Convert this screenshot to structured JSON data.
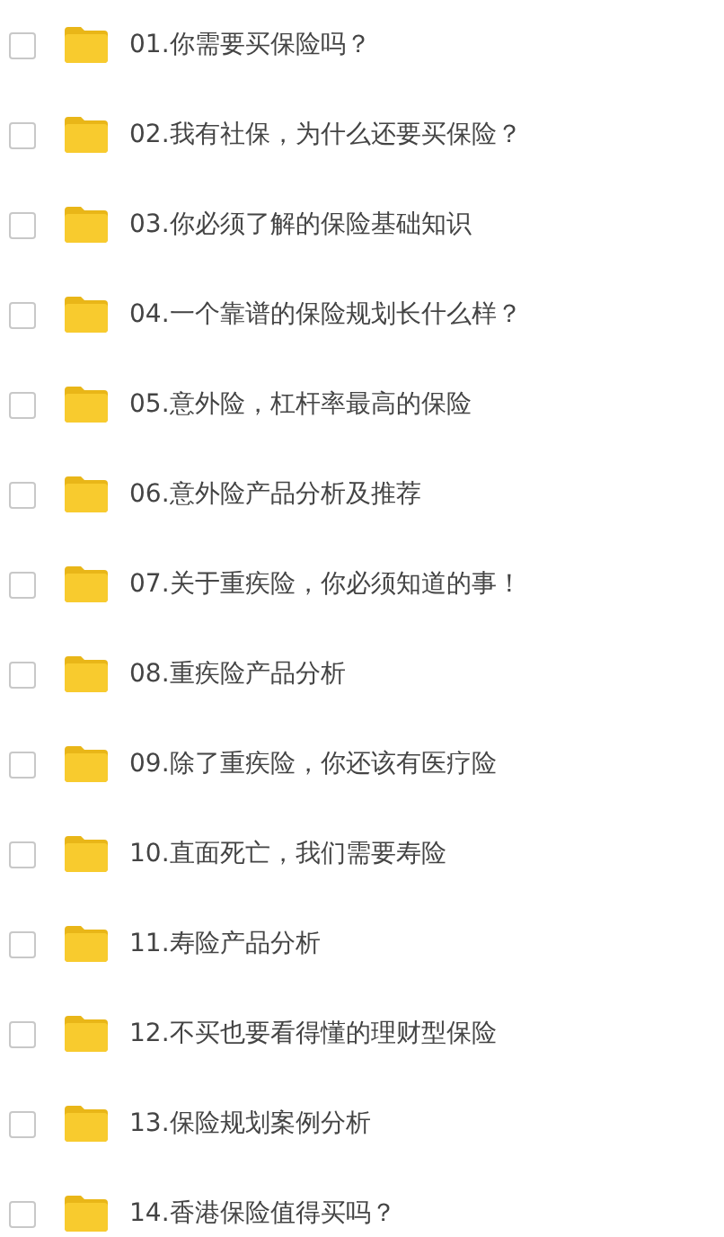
{
  "files": [
    {
      "name": "01.你需要买保险吗？",
      "checked": false
    },
    {
      "name": "02.我有社保，为什么还要买保险？",
      "checked": false
    },
    {
      "name": "03.你必须了解的保险基础知识",
      "checked": false
    },
    {
      "name": "04.一个靠谱的保险规划长什么样？",
      "checked": false
    },
    {
      "name": "05.意外险，杠杆率最高的保险",
      "checked": false
    },
    {
      "name": "06.意外险产品分析及推荐",
      "checked": false
    },
    {
      "name": "07.关于重疾险，你必须知道的事！",
      "checked": false
    },
    {
      "name": "08.重疾险产品分析",
      "checked": false
    },
    {
      "name": "09.除了重疾险，你还该有医疗险",
      "checked": false
    },
    {
      "name": "10.直面死亡，我们需要寿险",
      "checked": false
    },
    {
      "name": "11.寿险产品分析",
      "checked": false
    },
    {
      "name": "12.不买也要看得懂的理财型保险",
      "checked": false
    },
    {
      "name": "13.保险规划案例分析",
      "checked": false
    },
    {
      "name": "14.香港保险值得买吗？",
      "checked": false
    }
  ]
}
